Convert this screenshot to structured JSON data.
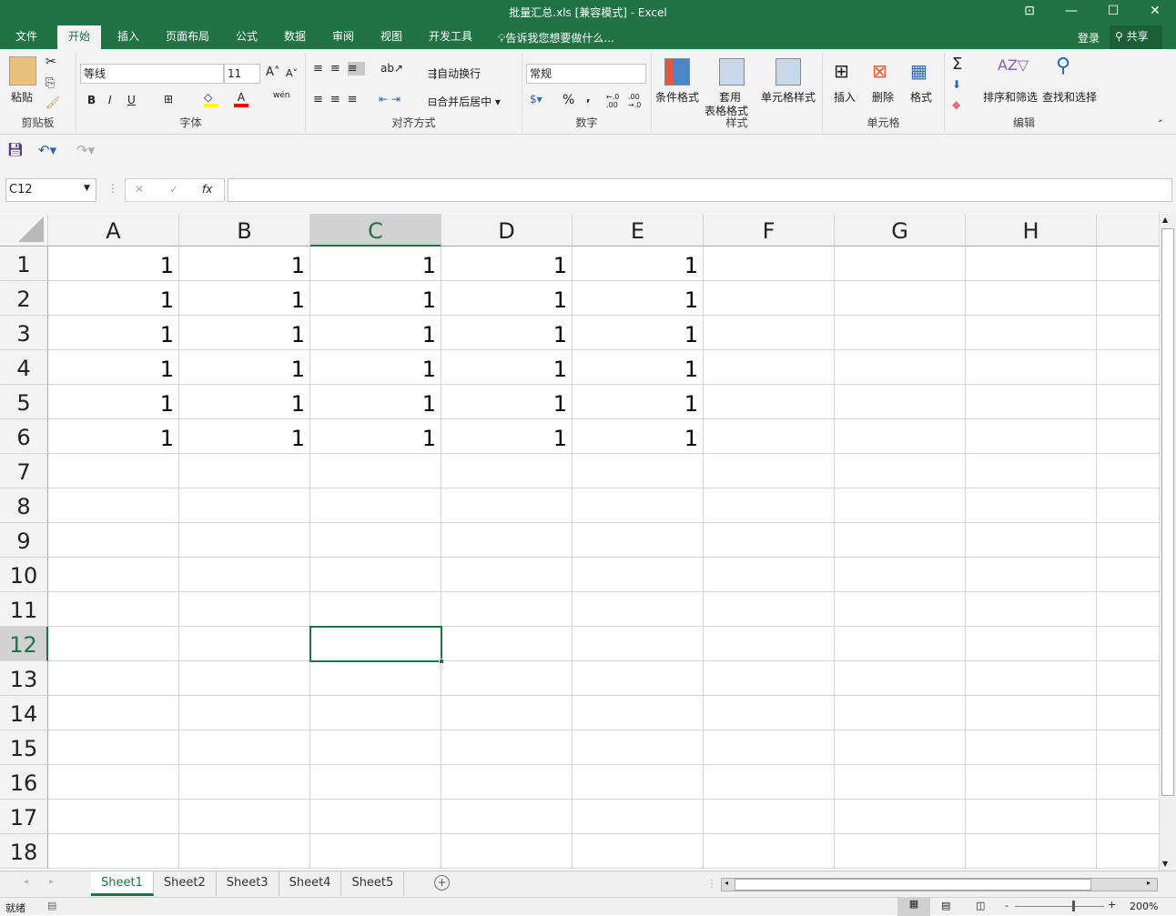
{
  "window": {
    "title": "批量汇总.xls  [兼容模式] - Excel"
  },
  "ribbon_tabs": [
    "文件",
    "开始",
    "插入",
    "页面布局",
    "公式",
    "数据",
    "审阅",
    "视图",
    "开发工具"
  ],
  "active_tab": "开始",
  "tell_me": "告诉我您想要做什么...",
  "account": {
    "signin": "登录",
    "share": "共享"
  },
  "clipboard": {
    "paste": "粘贴",
    "label": "剪贴板"
  },
  "font": {
    "name": "等线",
    "size": "11",
    "bold": "B",
    "italic": "I",
    "underline": "U",
    "phonetic": "wén",
    "label": "字体",
    "colors": {
      "highlight": "#ffff00",
      "font": "#ff0000"
    }
  },
  "alignment": {
    "wrap": "自动换行",
    "merge": "合并后居中",
    "label": "对齐方式"
  },
  "number": {
    "format": "常规",
    "percent": "%",
    "comma": ",",
    "inc": "←.0 .00",
    "dec": ".00 →.0",
    "label": "数字"
  },
  "styles": {
    "conditional": "条件格式",
    "table": "套用",
    "table2": "表格格式",
    "cell": "单元格样式",
    "label": "样式"
  },
  "cells": {
    "insert": "插入",
    "delete": "删除",
    "format": "格式",
    "label": "单元格"
  },
  "editing": {
    "sort": "排序和筛选",
    "find": "查找和选择",
    "label": "编辑"
  },
  "formula_bar": {
    "name_box": "C12",
    "fx": "fx",
    "value": ""
  },
  "grid": {
    "columns": [
      "A",
      "B",
      "C",
      "D",
      "E",
      "F",
      "G",
      "H"
    ],
    "rows": [
      "1",
      "2",
      "3",
      "4",
      "5",
      "6",
      "7",
      "8",
      "9",
      "10",
      "11",
      "12",
      "13",
      "14",
      "15",
      "16",
      "17",
      "18"
    ],
    "selected_cell": "C12",
    "data": [
      [
        "1",
        "1",
        "1",
        "1",
        "1"
      ],
      [
        "1",
        "1",
        "1",
        "1",
        "1"
      ],
      [
        "1",
        "1",
        "1",
        "1",
        "1"
      ],
      [
        "1",
        "1",
        "1",
        "1",
        "1"
      ],
      [
        "1",
        "1",
        "1",
        "1",
        "1"
      ],
      [
        "1",
        "1",
        "1",
        "1",
        "1"
      ]
    ]
  },
  "sheets": [
    "Sheet1",
    "Sheet2",
    "Sheet3",
    "Sheet4",
    "Sheet5"
  ],
  "active_sheet": "Sheet1",
  "status": {
    "ready": "就绪",
    "zoom": "200%"
  }
}
